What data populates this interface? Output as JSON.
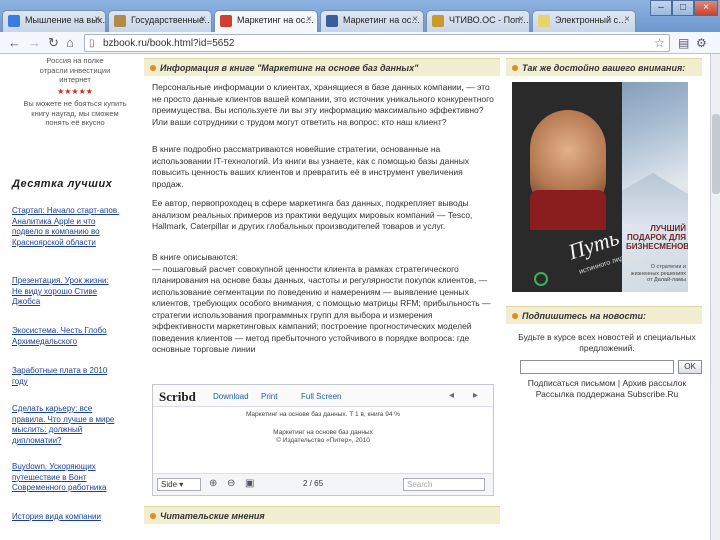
{
  "browser": {
    "tabs": [
      {
        "label": "Мышление на вых…",
        "favicon": "#3a7be0"
      },
      {
        "label": "Государственные…",
        "favicon": "#b08a48"
      },
      {
        "label": "Маркетинг на ос…",
        "favicon": "#d23d2d"
      },
      {
        "label": "Маркетинг на ос…",
        "favicon": "#3a5e9c"
      },
      {
        "label": "ЧТИВО.ОС - Поп…",
        "favicon": "#c79a2b"
      },
      {
        "label": "Электронный с…",
        "favicon": "#e9d26a"
      }
    ],
    "url": "bzbook.ru/book.html?id=5652",
    "window_controls": [
      "–",
      "□",
      "×"
    ]
  },
  "sidebar": {
    "promo_lines": [
      "Россия на полке",
      "отрасли инвестиции",
      "интернет"
    ],
    "stars": "★★★★★",
    "promo_text": "Вы можете не бояться купить книгу наугад, мы сможем понять её вкусно",
    "top_heading": "Десятка лучших",
    "top_items": [
      "Стартап: Начало старт-апов. Аналитика Apple и что подвело в компанию во Красноярской области",
      "Презентация. Урок жизни: Не виду хорошо Стиве Джобса",
      "Экосистема. Честь Глобо Архимедальского",
      "Заработные плата в 2010 году",
      "Сделать карьеру: все правила. Что лучше в мире мыслить: должный дипломатии?",
      "Buydown. Ускоряющих путешествие в Бонт Современного работника",
      "История вида компании"
    ]
  },
  "main": {
    "info_header": "Информация в книге \"Маркетинг на основе баз данных\"",
    "paragraphs": [
      "Персональные информации о клиентах, хранящиеся в базе данных компании, — это не просто данные клиентов вашей компании, это источник уникального конкурентного преимущества. Вы используете ли вы эту информацию максимально эффективно? Или ваши сотрудники с трудом могут ответить на вопрос: кто наш клиент?",
      "В книге подробно рассматриваются новейшие стратегии, основанные на использовании IT-технологий. Из книги вы узнаете, как с помощью базы данных повысить ценность ваших клиентов и превратить её в инструмент увеличения продаж.",
      "Ее автор, первопроходец в сфере маркетинга баз данных, подкрепляет выводы анализом реальных примеров из практики ведущих мировых компаний — Tesco, Hallmark, Caterpillar и других глобальных производителей товаров и услуг.",
      "В книге описываются:\n— пошаговый расчет совокупной ценности клиента в рамках стратегического планирования на основе базы данных, частоты и регулярности покупок клиентов, — использование сегментации по поведению и намерениям — выявление ценных клиентов, требующих особого внимания, с помощью матрицы RFM; прибыльность — стратегии использования программных групп для выбора и измерения эффективности маркетинговых кампаний; построение прогностических моделей поведения клиентов — метод пребыточного устойчивого в порядке вопроса: где основные торговые линии"
    ],
    "viewer": {
      "logo": "Scribd",
      "menu": [
        "Download",
        "Print",
        "Full Screen"
      ],
      "doc_title": "Маркетинг на основе баз данных. Т 1 в, книга 94 %",
      "doc_lines": [
        "Маркетинг на основе баз данных",
        "© Издательство «Питер», 2010"
      ],
      "zoom": "Side",
      "page": "2 / 65",
      "search_placeholder": "Search"
    },
    "reviews_header": "Читательские мнения"
  },
  "right": {
    "also_header": "Так же достойно вашего внимания:",
    "book": {
      "title_top": "Путь",
      "title_sub": "истинного лидера",
      "gift": "ЛУЧШИЙ ПОДАРОК ДЛЯ БИЗНЕСМЕНОВ",
      "tagline": "О стратегии и жизненных решениях от Далай-ламы",
      "accent": "#8a1d1d"
    },
    "subscribe_header": "Подпишитесь на новости:",
    "subscribe_text": "Будьте в курсе всех новостей и специальных предложений.",
    "email_placeholder": "",
    "ok_label": "OK",
    "links": [
      "Подписаться письмом",
      "Архив рассылок",
      "Рассылка поддержана",
      "Subscribe.Ru"
    ]
  }
}
